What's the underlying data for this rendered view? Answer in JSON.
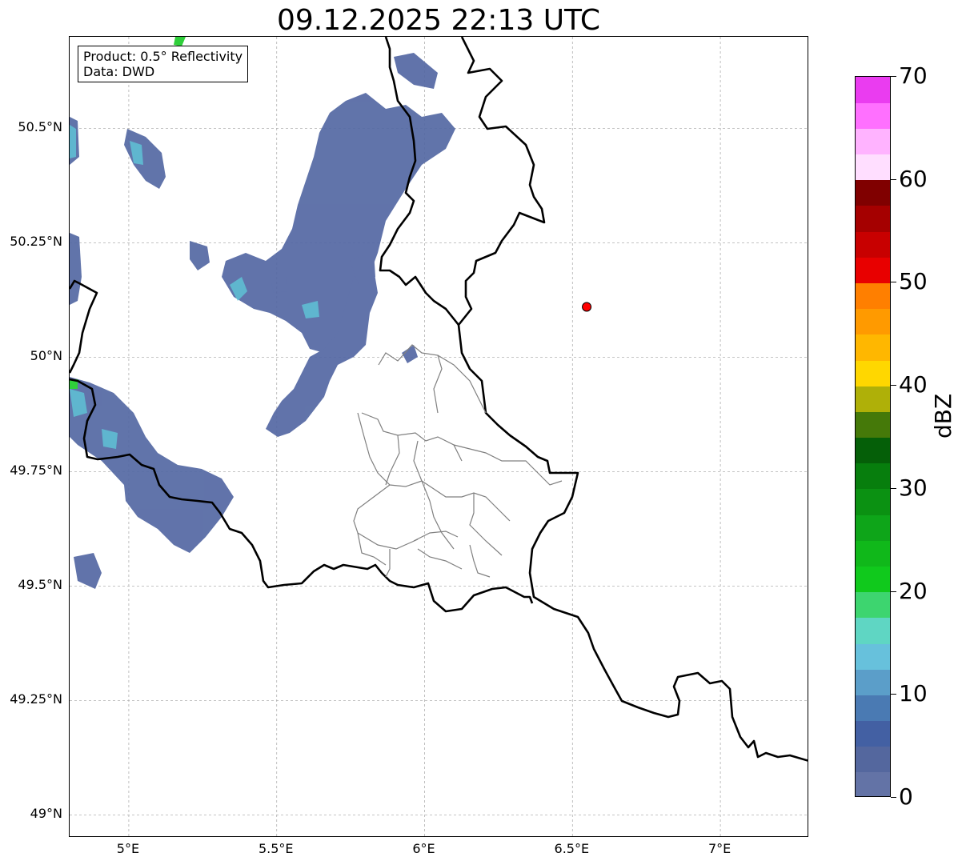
{
  "title": "09.12.2025 22:13 UTC",
  "info": {
    "product": "Product: 0.5° Reflectivity",
    "data": "Data: DWD"
  },
  "map": {
    "lon_range": [
      4.8,
      7.3
    ],
    "lat_range": [
      48.95,
      50.7
    ],
    "x_ticks": [
      {
        "lon": 5.0,
        "label": "5°E"
      },
      {
        "lon": 5.5,
        "label": "5.5°E"
      },
      {
        "lon": 6.0,
        "label": "6°E"
      },
      {
        "lon": 6.5,
        "label": "6.5°E"
      },
      {
        "lon": 7.0,
        "label": "7°E"
      }
    ],
    "y_ticks": [
      {
        "lat": 50.5,
        "label": "50.5°N"
      },
      {
        "lat": 50.25,
        "label": "50.25°N"
      },
      {
        "lat": 50.0,
        "label": "50°N"
      },
      {
        "lat": 49.75,
        "label": "49.75°N"
      },
      {
        "lat": 49.5,
        "label": "49.5°N"
      },
      {
        "lat": 49.25,
        "label": "49.25°N"
      },
      {
        "lat": 49.0,
        "label": "49°N"
      }
    ],
    "radar_site": {
      "lon": 6.548,
      "lat": 50.11,
      "color": "#ff0000"
    },
    "colors": {
      "border": "#000000",
      "admin": "#808080",
      "grid": "#b0b0b0"
    }
  },
  "colorbar": {
    "unit": "dBZ",
    "min": 0,
    "max": 70,
    "ticks": [
      {
        "value": 0,
        "label": "0"
      },
      {
        "value": 10,
        "label": "10"
      },
      {
        "value": 20,
        "label": "20"
      },
      {
        "value": 30,
        "label": "30"
      },
      {
        "value": 40,
        "label": "40"
      },
      {
        "value": 50,
        "label": "50"
      },
      {
        "value": 60,
        "label": "60"
      },
      {
        "value": 70,
        "label": "70"
      }
    ],
    "colors": [
      "#6373a6",
      "#54679e",
      "#4360a3",
      "#4a7ab3",
      "#5b9ec9",
      "#67c1dc",
      "#5fd6c3",
      "#3dd56f",
      "#10c91c",
      "#10b81a",
      "#0ea519",
      "#0b9112",
      "#077e0d",
      "#055f08",
      "#457909",
      "#afb008",
      "#ffd700",
      "#ffb700",
      "#ff9a00",
      "#ff7f00",
      "#e80000",
      "#c80000",
      "#a50000",
      "#800000",
      "#ffdeff",
      "#ffb3ff",
      "#ff70ff",
      "#ea3cf0"
    ]
  }
}
